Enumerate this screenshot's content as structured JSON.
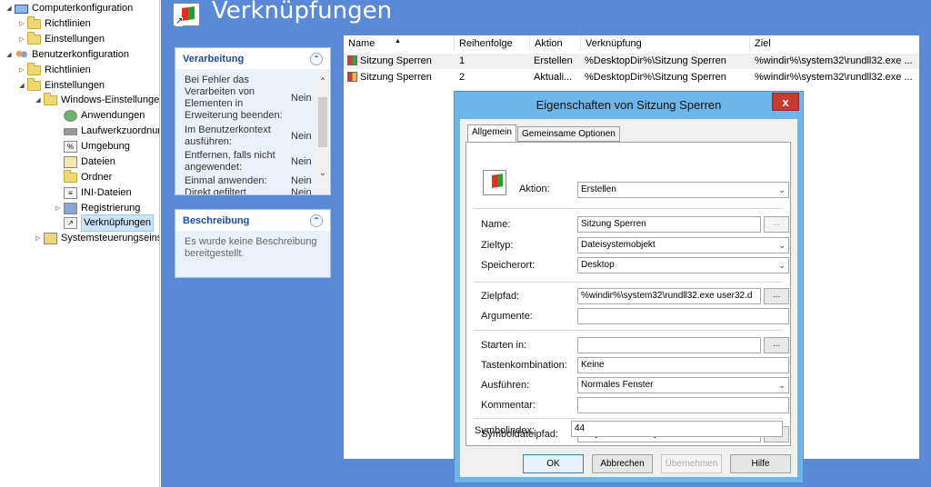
{
  "tree": {
    "items": [
      {
        "label": "Computerkonfiguration",
        "twisty": "◢",
        "icon": "pc"
      },
      {
        "label": "Richtlinien",
        "twisty": "▷",
        "icon": "folder"
      },
      {
        "label": "Einstellungen",
        "twisty": "▷",
        "icon": "folder"
      },
      {
        "label": "Benutzerkonfiguration",
        "twisty": "◢",
        "icon": "users"
      },
      {
        "label": "Richtlinien",
        "twisty": "▷",
        "icon": "folder"
      },
      {
        "label": "Einstellungen",
        "twisty": "◢",
        "icon": "folder"
      },
      {
        "label": "Windows-Einstellungen",
        "twisty": "◢",
        "icon": "folder"
      },
      {
        "label": "Anwendungen",
        "twisty": "",
        "icon": "app"
      },
      {
        "label": "Laufwerkzuordnungen",
        "twisty": "",
        "icon": "drive"
      },
      {
        "label": "Umgebung",
        "twisty": "",
        "icon": "env"
      },
      {
        "label": "Dateien",
        "twisty": "",
        "icon": "file"
      },
      {
        "label": "Ordner",
        "twisty": "",
        "icon": "folder"
      },
      {
        "label": "INI-Dateien",
        "twisty": "",
        "icon": "ini"
      },
      {
        "label": "Registrierung",
        "twisty": "▷",
        "icon": "reg"
      },
      {
        "label": "Verknüpfungen",
        "twisty": "",
        "icon": "shortcut"
      },
      {
        "label": "Systemsteuerungseinstellungen",
        "twisty": "▷",
        "icon": "cp"
      }
    ]
  },
  "header": {
    "title": "Verknüpfungen"
  },
  "processing": {
    "title": "Verarbeitung",
    "collapse_glyph": "⌃",
    "rows": [
      {
        "key": "Bei Fehler das Verarbeiten von Elementen in Erweiterung beenden:",
        "value": "Nein"
      },
      {
        "key": "Im Benutzerkontext ausführen:",
        "value": "Nein"
      },
      {
        "key": "Entfernen, falls nicht angewendet:",
        "value": "Nein"
      },
      {
        "key": "Einmal anwenden:",
        "value": "Nein"
      },
      {
        "key": "Direkt gefiltert",
        "value": "Nein"
      }
    ]
  },
  "description": {
    "title": "Beschreibung",
    "collapse_glyph": "⌃",
    "text": "Es wurde keine Beschreibung bereitgestellt."
  },
  "list": {
    "columns": [
      "Name",
      "Reihenfolge",
      "Aktion",
      "Verknüpfung",
      "Ziel"
    ],
    "sort_glyph": "▲",
    "rows": [
      {
        "name": "Sitzung Sperren",
        "order": "1",
        "action": "Erstellen",
        "link": "%DesktopDir%\\Sitzung Sperren",
        "target": "%windir%\\system32\\rundll32.exe ..."
      },
      {
        "name": "Sitzung Sperren",
        "order": "2",
        "action": "Aktuali...",
        "link": "%DesktopDir%\\Sitzung Sperren",
        "target": "%windir%\\system32\\rundll32.exe ..."
      }
    ]
  },
  "dialog": {
    "title": "Eigenschaften von Sitzung Sperren",
    "close_glyph": "x",
    "tabs": [
      "Allgemein",
      "Gemeinsame Optionen"
    ],
    "action_label": "Aktion:",
    "action_value": "Erstellen",
    "name_label": "Name:",
    "name_value": "Sitzung Sperren",
    "target_type_label": "Zieltyp:",
    "target_type_value": "Dateisystemobjekt",
    "location_label": "Speicherort:",
    "location_value": "Desktop",
    "target_path_label": "Zielpfad:",
    "target_path_value": "%windir%\\system32\\rundll32.exe user32.d",
    "arguments_label": "Argumente:",
    "arguments_value": "",
    "start_in_label": "Starten in:",
    "start_in_value": "",
    "hotkey_label": "Tastenkombination:",
    "hotkey_value": "Keine",
    "run_label": "Ausführen:",
    "run_value": "Normales Fenster",
    "comment_label": "Kommentar:",
    "comment_value": "",
    "icon_path_label": "Symboldateipfad:",
    "icon_path_value": "%SystemRoot%\\system32\\SHELL32.dll",
    "icon_index_label": "Symbolindex:",
    "icon_index_value": "44",
    "browse_glyph": "...",
    "dropdown_glyph": "⌄",
    "buttons": {
      "ok": "OK",
      "cancel": "Abbrechen",
      "apply": "Übernehmen",
      "help": "Hilfe"
    }
  }
}
